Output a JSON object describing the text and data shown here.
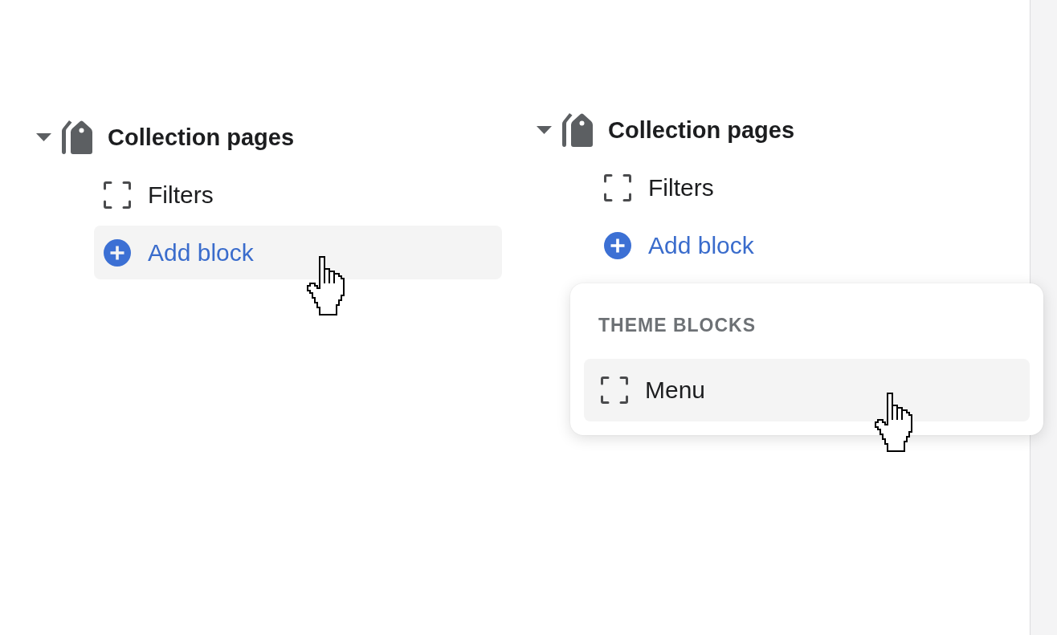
{
  "panels": [
    {
      "section": {
        "title": "Collection pages",
        "expanded": true,
        "rows": [
          {
            "kind": "block",
            "label": "Filters",
            "hovered": false
          },
          {
            "kind": "add",
            "label": "Add block",
            "hovered": true
          }
        ]
      }
    },
    {
      "section": {
        "title": "Collection pages",
        "expanded": true,
        "rows": [
          {
            "kind": "block",
            "label": "Filters",
            "hovered": false
          },
          {
            "kind": "add",
            "label": "Add block",
            "hovered": false
          }
        ]
      },
      "block_picker": {
        "heading": "THEME BLOCKS",
        "items": [
          {
            "kind": "block",
            "label": "Menu",
            "hovered": true
          }
        ]
      }
    }
  ]
}
